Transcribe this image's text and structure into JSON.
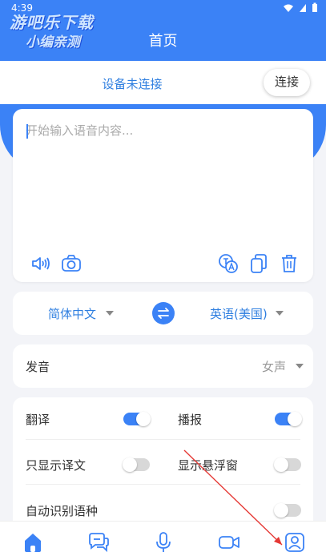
{
  "status_bar": {
    "time": "4:39"
  },
  "watermark": {
    "line1": "游吧乐下载",
    "line2": "小编亲测"
  },
  "header": {
    "title": "首页"
  },
  "device": {
    "status": "设备未连接",
    "connect_label": "连接"
  },
  "input": {
    "placeholder": "开始输入语音内容..."
  },
  "input_toolbar": {
    "icons": [
      "speaker-icon",
      "camera-icon",
      "translate-voice-icon",
      "copy-icon",
      "trash-icon"
    ]
  },
  "language": {
    "source": "简体中文",
    "target": "英语(美国)"
  },
  "voice": {
    "label": "发音",
    "value": "女声"
  },
  "settings": {
    "translate": {
      "label": "翻译",
      "on": true
    },
    "broadcast": {
      "label": "播报",
      "on": true
    },
    "only_translation": {
      "label": "只显示译文",
      "on": false
    },
    "floating_window": {
      "label": "显示悬浮窗",
      "on": false
    },
    "auto_detect": {
      "label": "自动识别语种",
      "on": false
    }
  },
  "bottom_nav": [
    "home-icon",
    "chat-icon",
    "mic-icon",
    "video-icon",
    "profile-icon"
  ],
  "colors": {
    "accent": "#3b82f6",
    "link": "#2f7fe0",
    "annotation": "#e53935"
  }
}
